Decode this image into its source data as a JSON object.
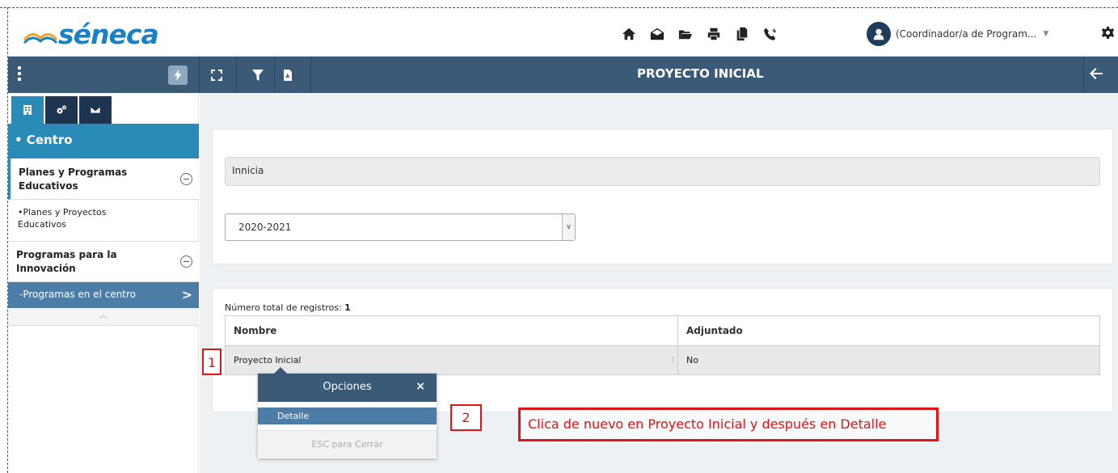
{
  "header": {
    "logo_text": "séneca",
    "user_label": "(Coordinador/a de Program...",
    "icons": [
      "home-icon",
      "envelope-open-icon",
      "folder-open-icon",
      "print-icon",
      "copy-icon",
      "phone-icon"
    ]
  },
  "toolbar": {
    "title": "PROYECTO INICIAL"
  },
  "sidebar": {
    "section_title": "• Centro",
    "groups": [
      {
        "label": "Planes y Programas Educativos",
        "items": [
          "•Planes y Proyectos Educativos"
        ]
      },
      {
        "label": "Programas para la Innovación",
        "items": [
          "-Programas en el centro"
        ]
      }
    ]
  },
  "form": {
    "name_value": "Innicia",
    "year_value": "2020-2021"
  },
  "table": {
    "count_label": "Número total de registros:",
    "count_value": "1",
    "columns": [
      "Nombre",
      "Adjuntado"
    ],
    "rows": [
      [
        "Proyecto Inicial",
        "No"
      ]
    ]
  },
  "popup": {
    "title": "Opciones",
    "close": "×",
    "item": "Detalle",
    "esc": "ESC para Cerrar"
  },
  "annotations": {
    "step1": "1",
    "step2": "2",
    "instruction": "Clica de nuevo en Proyecto Inicial y después en Detalle"
  },
  "colors": {
    "navy": "#3a5a78",
    "accent_blue": "#2a8ab8",
    "selected_blue": "#4d7da6",
    "annotation_red": "#e01414"
  }
}
